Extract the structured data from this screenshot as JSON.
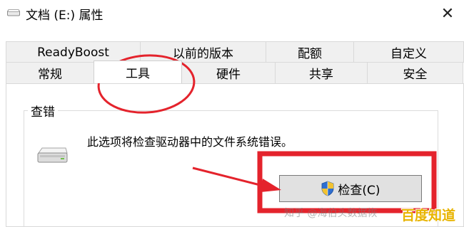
{
  "window": {
    "title": "文档 (E:) 属性",
    "close_glyph": "✕"
  },
  "tabs_row1": [
    "ReadyBoost",
    "以前的版本",
    "配额",
    "自定义"
  ],
  "tabs_row2": [
    "常规",
    "工具",
    "硬件",
    "共享",
    "安全"
  ],
  "active_tab": "工具",
  "group": {
    "label": "查错",
    "description": "此选项将检查驱动器中的文件系统错误。",
    "check_button": "检查(C)"
  },
  "watermarks": [
    "知乎 @海伯头数据恢",
    "百度知道"
  ],
  "colors": {
    "annotation_red": "#e4232c",
    "watermark_yellow": "#e8b400"
  },
  "icons": [
    "drive-icon",
    "shield-icon",
    "close-icon"
  ]
}
